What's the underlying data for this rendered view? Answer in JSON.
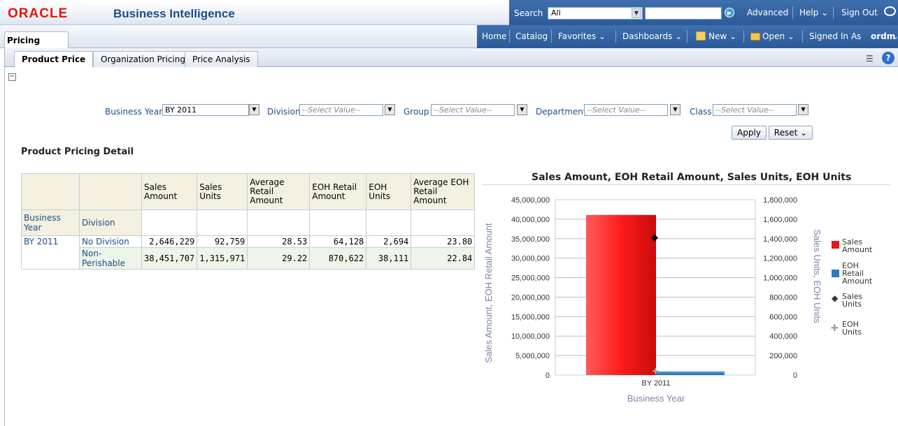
{
  "header": {
    "logo": "ORACLE",
    "product": "Business Intelligence",
    "search_label": "Search",
    "search_scope": "All",
    "advanced": "Advanced",
    "help": "Help ⌄",
    "sign_out": "Sign Out"
  },
  "nav": {
    "page_tab": "Pricing",
    "home": "Home",
    "catalog": "Catalog",
    "favorites": "Favorites ⌄",
    "dashboards": "Dashboards ⌄",
    "new": "New ⌄",
    "open": "Open ⌄",
    "signed_in_as": "Signed In As",
    "user": "ordm"
  },
  "tabs": [
    {
      "label": "Product Price"
    },
    {
      "label": "Organization Pricing"
    },
    {
      "label": "Price Analysis"
    }
  ],
  "prompts": {
    "business_year_label": "Business Year",
    "business_year_value": "BY 2011",
    "division_label": "Division",
    "division_value": "--Select Value--",
    "group_label": "Group",
    "group_value": "--Select Value--",
    "department_label": "Department",
    "department_value": "--Select Value--",
    "class_label": "Class",
    "class_value": "--Select Value--",
    "apply": "Apply",
    "reset": "Reset ⌄"
  },
  "section_title": "Product Pricing Detail",
  "table": {
    "columns": [
      "Sales Amount",
      "Sales Units",
      "Average Retail Amount",
      "EOH Retail Amount",
      "EOH Units",
      "Average EOH Retail Amount"
    ],
    "row_headers": [
      "Business Year",
      "Division"
    ],
    "rows": [
      {
        "year": "BY 2011",
        "division": "No Division",
        "values": [
          "2,646,229",
          "92,759",
          "28.53",
          "64,128",
          "2,694",
          "23.80"
        ]
      },
      {
        "year": "",
        "division": "Non-Perishable",
        "values": [
          "38,451,707",
          "1,315,971",
          "29.22",
          "870,622",
          "38,111",
          "22.84"
        ]
      }
    ]
  },
  "chart_data": {
    "type": "bar",
    "title": "Sales Amount, EOH Retail Amount, Sales Units, EOH Units",
    "xlabel": "Business Year",
    "ylabel": "Sales Amount, EOH Retail Amount",
    "y2label": "Sales Units, EOH Units",
    "categories": [
      "BY 2011"
    ],
    "ylim": [
      0,
      45000000
    ],
    "y2lim": [
      0,
      1800000
    ],
    "yticks": [
      "0",
      "5,000,000",
      "10,000,000",
      "15,000,000",
      "20,000,000",
      "25,000,000",
      "30,000,000",
      "35,000,000",
      "40,000,000",
      "45,000,000"
    ],
    "y2ticks": [
      "0",
      "200,000",
      "400,000",
      "600,000",
      "800,000",
      "1,000,000",
      "1,200,000",
      "1,400,000",
      "1,600,000",
      "1,800,000"
    ],
    "series": [
      {
        "name": "Sales Amount",
        "axis": "y",
        "kind": "bar",
        "color": "#e8141b",
        "values": [
          41097936
        ]
      },
      {
        "name": "EOH Retail Amount",
        "axis": "y",
        "kind": "bar",
        "color": "#2a7bc0",
        "values": [
          934750
        ]
      },
      {
        "name": "Sales Units",
        "axis": "y2",
        "kind": "point",
        "color": "#000000",
        "values": [
          1408730
        ]
      },
      {
        "name": "EOH Units",
        "axis": "y2",
        "kind": "point",
        "color": "#9aa7a5",
        "values": [
          40805
        ]
      }
    ],
    "legend": "right",
    "legend_labels": [
      [
        "Sales",
        "Amount"
      ],
      [
        "EOH",
        "Retail",
        "Amount"
      ],
      [
        "Sales",
        "Units"
      ],
      [
        "EOH",
        "Units"
      ]
    ]
  }
}
